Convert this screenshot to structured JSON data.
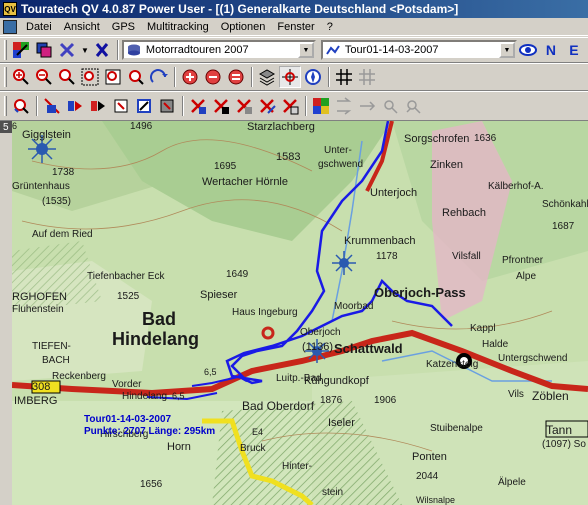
{
  "window": {
    "title": "Touratech QV 4.0.87 Power User - [(1) Generalkarte Deutschland <Potsdam>]"
  },
  "menu": [
    "Datei",
    "Ansicht",
    "GPS",
    "Multitracking",
    "Optionen",
    "Fenster",
    "?"
  ],
  "toolbar": {
    "folder_combo": "Motorradtouren 2007",
    "track_combo": "Tour01-14-03-2007"
  },
  "map": {
    "scale_label": "5 km",
    "tour_name": "Tour01-14-03-2007",
    "tour_stats": "Punkte: 2707  Länge: 295km",
    "places": [
      {
        "name": "Starzlachberg",
        "size": 11
      },
      {
        "name": "Gigglstein",
        "size": 11
      },
      {
        "name": "1496",
        "size": 10
      },
      {
        "name": "1738",
        "size": 10
      },
      {
        "name": "Grüntenhaus",
        "size": 10
      },
      {
        "name": "(1535)",
        "size": 10
      },
      {
        "name": "1583",
        "size": 11
      },
      {
        "name": "Unter-",
        "size": 10
      },
      {
        "name": "gschwend",
        "size": 10
      },
      {
        "name": "1695",
        "size": 10
      },
      {
        "name": "Wertacher Hörnle",
        "size": 11
      },
      {
        "name": "Sorgschrofen",
        "size": 11
      },
      {
        "name": "1636",
        "size": 10
      },
      {
        "name": "Zinken",
        "size": 11
      },
      {
        "name": "Unterjoch",
        "size": 11
      },
      {
        "name": "Kälberhof-A.",
        "size": 10
      },
      {
        "name": "Schönkahle",
        "size": 10
      },
      {
        "name": "Rehbach",
        "size": 11
      },
      {
        "name": "1687",
        "size": 10
      },
      {
        "name": "Auf dem Ried",
        "size": 10
      },
      {
        "name": "Krummenbach",
        "size": 11
      },
      {
        "name": "1178",
        "size": 10
      },
      {
        "name": "Vilsfall",
        "size": 10
      },
      {
        "name": "Pfrontner",
        "size": 10
      },
      {
        "name": "Alpe",
        "size": 10
      },
      {
        "name": "1649",
        "size": 10
      },
      {
        "name": "Tiefenbacher Eck",
        "size": 10
      },
      {
        "name": "Spieser",
        "size": 11
      },
      {
        "name": "Oberjoch-Pass",
        "size": 13
      },
      {
        "name": "Moorbad",
        "size": 10
      },
      {
        "name": "RGHOFEN",
        "size": 11
      },
      {
        "name": "Fluhenstein",
        "size": 10
      },
      {
        "name": "1525",
        "size": 10
      },
      {
        "name": "Haus Ingeburg",
        "size": 10
      },
      {
        "name": "Bad",
        "size": 18
      },
      {
        "name": "Hindelang",
        "size": 18
      },
      {
        "name": "Kappl",
        "size": 10
      },
      {
        "name": "Halde",
        "size": 10
      },
      {
        "name": "Untergschwend",
        "size": 10
      },
      {
        "name": "Oberjoch",
        "size": 10
      },
      {
        "name": "(1136)",
        "size": 11
      },
      {
        "name": "Schattwald",
        "size": 13
      },
      {
        "name": "TIEFEN-",
        "size": 10
      },
      {
        "name": "BACH",
        "size": 10
      },
      {
        "name": "Reckenberg",
        "size": 10
      },
      {
        "name": "Vorder",
        "size": 10
      },
      {
        "name": "Hindelang",
        "size": 10
      },
      {
        "name": "Katzensteig",
        "size": 10
      },
      {
        "name": "Kühgundkopf",
        "size": 11
      },
      {
        "name": "Luitp.-Bad",
        "size": 10
      },
      {
        "name": "Zöblen",
        "size": 12
      },
      {
        "name": "308",
        "size": 11
      },
      {
        "name": "IMBERG",
        "size": 11
      },
      {
        "name": "1876",
        "size": 10
      },
      {
        "name": "1906",
        "size": 10
      },
      {
        "name": "Bad Oberdorf",
        "size": 12
      },
      {
        "name": "Iseler",
        "size": 11
      },
      {
        "name": "Stuibenalpe",
        "size": 10
      },
      {
        "name": "Tann",
        "size": 12
      },
      {
        "name": "(1097) So",
        "size": 10
      },
      {
        "name": "Hirschberg",
        "size": 10
      },
      {
        "name": "Horn",
        "size": 11
      },
      {
        "name": "Bruck",
        "size": 10
      },
      {
        "name": "Hinter-",
        "size": 10
      },
      {
        "name": "Ponten",
        "size": 11
      },
      {
        "name": "2044",
        "size": 10
      },
      {
        "name": "1656",
        "size": 10
      },
      {
        "name": "stein",
        "size": 10
      },
      {
        "name": "Älpele",
        "size": 10
      },
      {
        "name": "Wilsnalpe",
        "size": 9
      },
      {
        "name": "Vils",
        "size": 10
      },
      {
        "name": "6,5",
        "size": 9
      },
      {
        "name": "6,5",
        "size": 9
      },
      {
        "name": "E4",
        "size": 9
      },
      {
        "name": "6",
        "size": 9
      }
    ]
  },
  "colors": {
    "titlebar": "#0a246a",
    "track": "#1a1ae6",
    "route_red": "#c8261a",
    "yellow_road": "#f0e020"
  }
}
